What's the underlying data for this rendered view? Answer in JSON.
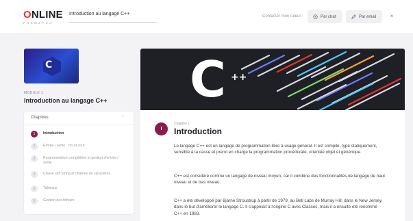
{
  "header": {
    "logo_main": "NLINE",
    "logo_o": "O",
    "logo_sub": "FORMAPRO",
    "course_title": "Introduction au langage C++",
    "contact_label": "Contacter mon tuteur :",
    "chat_label": "Par chat",
    "email_label": "Par email",
    "close_glyph": "×"
  },
  "module": {
    "thumb_glyph": "C",
    "label": "MODULE 1",
    "title": "Introduction au langage C++"
  },
  "chapters": {
    "header": "Chapitres",
    "items": [
      {
        "num": "1",
        "label": "Introduction",
        "active": true
      },
      {
        "num": "2",
        "label": "Entrée / sortie : cin et cout",
        "active": false
      },
      {
        "num": "3",
        "label": "Programmation compétitive et gestion d'entrée / sortie",
        "active": false
      },
      {
        "num": "4",
        "label": "Classe std::string et chaînes de caractères",
        "active": false
      },
      {
        "num": "5",
        "label": "Tableaux",
        "active": false
      },
      {
        "num": "6",
        "label": "Gestion des fichiers",
        "active": false
      }
    ]
  },
  "content": {
    "hero_glyph": "C",
    "hero_plus": "++",
    "chapter_num": "I",
    "chapter_kicker": "Chapitre 1",
    "chapter_title": "Introduction",
    "paragraphs": [
      "Le langage C++ est un langage de programmation libre à usage général. Il est compilé, typé statiquement, sensible à la casse et prend en charge la programmation procédurale, orientée objet et générique.",
      "C++ est considéré comme un langage de niveau moyen, car il combine des fonctionnalités de langage de haut niveau et de bas niveau.",
      "C++ a été développé par Bjarne Stroustrup à partir de 1979, au Bell Labs de Murray Hill, dans le New Jersey, dans le but d'améliorer le langage C. Il s'appelait à l'origine C avec Classes, mais il a ensuite été renommé C++ en 1983."
    ]
  },
  "colors": {
    "accent": "#8a1c4b",
    "logo_red": "#e2352b"
  }
}
